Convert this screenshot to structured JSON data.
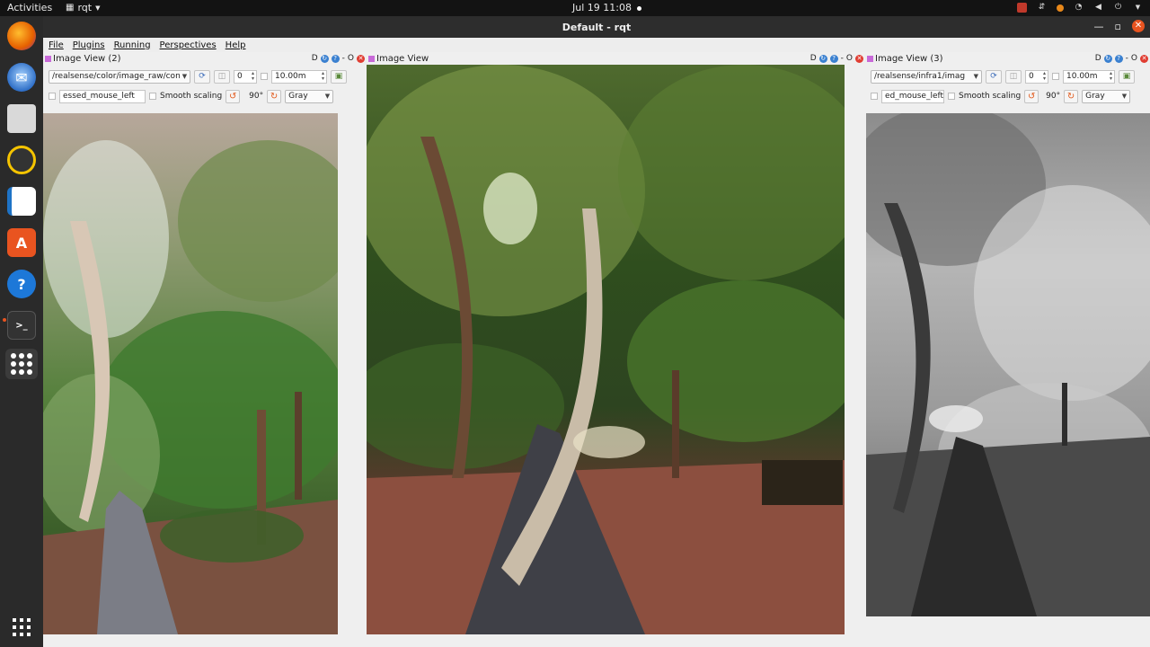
{
  "topbar": {
    "activities": "Activities",
    "app": "rqt",
    "clock": "Jul 19  11:08"
  },
  "window": {
    "title": "Default - rqt"
  },
  "menu": [
    "File",
    "Plugins",
    "Running",
    "Perspectives",
    "Help"
  ],
  "panes": [
    {
      "title": "Image View (2)",
      "topic": "/realsense/color/image_raw/con",
      "spin_value": "0",
      "range": "10.00m",
      "mouse_topic": "essed_mouse_left",
      "smooth_scaling": "Smooth scaling",
      "rotation": "90°",
      "colormap": "Gray",
      "title_right_letters": "D",
      "title_right_minus": "-",
      "title_right_o": "O"
    },
    {
      "title": "Image View",
      "title_right_letters": "D",
      "title_right_minus": "-",
      "title_right_o": "O"
    },
    {
      "title": "Image View (3)",
      "topic": "/realsense/infra1/imag",
      "spin_value": "0",
      "range": "10.00m",
      "mouse_topic": "ed_mouse_left",
      "smooth_scaling": "Smooth scaling",
      "rotation": "90°",
      "colormap": "Gray",
      "title_right_letters": "D",
      "title_right_minus": "-",
      "title_right_o": "O"
    }
  ],
  "colors": {
    "accent": "#e95420",
    "dock": "#2a2a2a",
    "close_red": "#e03c31"
  }
}
